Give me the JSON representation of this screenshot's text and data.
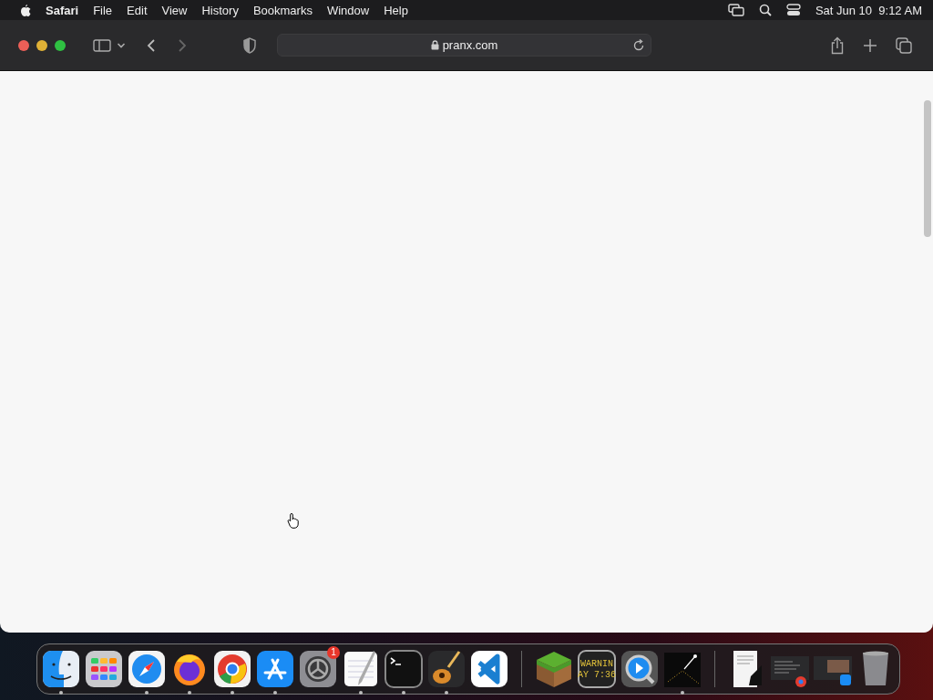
{
  "menu_bar": {
    "app_name": "Safari",
    "menus": [
      "File",
      "Edit",
      "View",
      "History",
      "Bookmarks",
      "Window",
      "Help"
    ],
    "clock": "Sat Jun 10  9:12 AM"
  },
  "browser": {
    "address": "pranx.com",
    "back_disabled": false,
    "forward_disabled": true
  },
  "dock": {
    "apps": [
      {
        "kind": "finder",
        "running": true
      },
      {
        "kind": "launchpad",
        "running": false
      },
      {
        "kind": "safari",
        "running": true
      },
      {
        "kind": "firefox",
        "running": true
      },
      {
        "kind": "chrome",
        "running": true
      },
      {
        "kind": "appstore",
        "running": true
      },
      {
        "kind": "settings",
        "running": false,
        "badge": "1"
      },
      {
        "kind": "textedit",
        "running": true
      },
      {
        "kind": "terminal",
        "running": true
      },
      {
        "kind": "guitar",
        "running": true
      },
      {
        "kind": "vscode",
        "running": false
      },
      {
        "kind": "separator"
      },
      {
        "kind": "grassblock",
        "running": false
      },
      {
        "kind": "console",
        "running": false,
        "lines": [
          "WARNIN",
          "AY 7:36"
        ]
      },
      {
        "kind": "quicktime",
        "running": false
      },
      {
        "kind": "starfield",
        "running": true
      },
      {
        "kind": "separator"
      },
      {
        "kind": "document"
      },
      {
        "kind": "window-chrome"
      },
      {
        "kind": "window-appstore"
      },
      {
        "kind": "trash"
      }
    ]
  }
}
